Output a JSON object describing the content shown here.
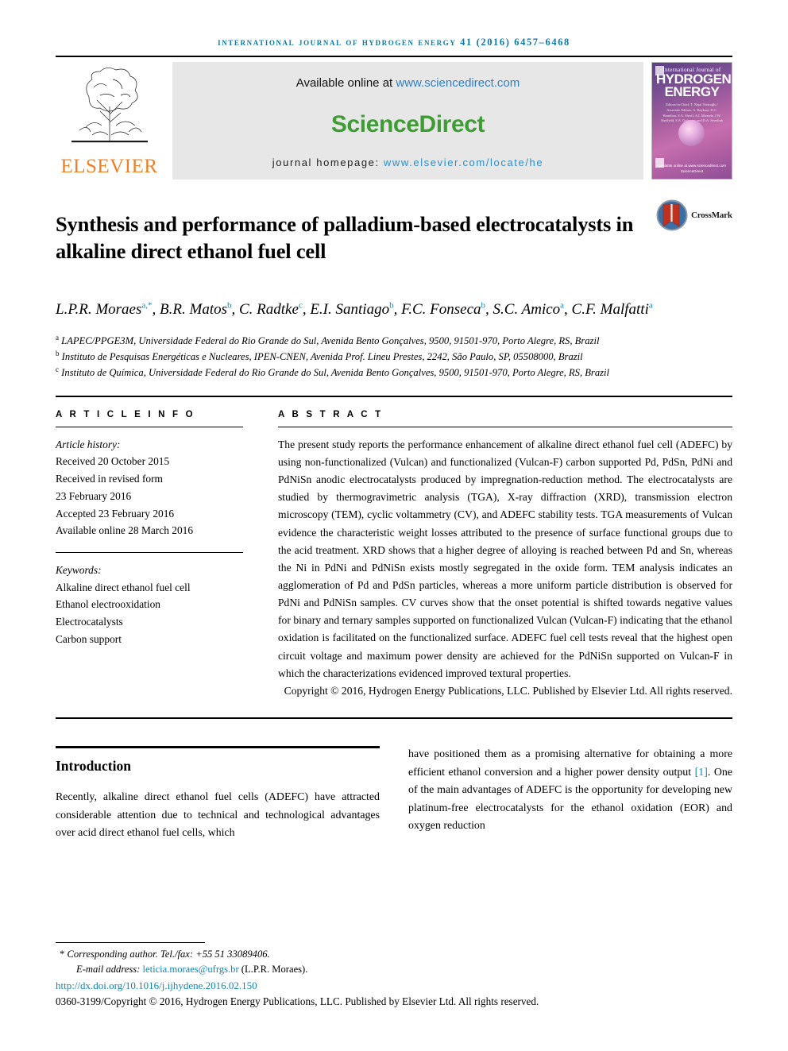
{
  "running_head": "International Journal of Hydrogen Energy 41 (2016) 6457–6468",
  "masthead": {
    "publisher": "ELSEVIER",
    "available_prefix": "Available online at ",
    "available_url": "www.sciencedirect.com",
    "sciencedirect_logo": "ScienceDirect",
    "homepage_prefix": "journal homepage: ",
    "homepage_url": "www.elsevier.com/locate/he",
    "cover": {
      "line1": "International Journal of",
      "line2": "HYDROGEN",
      "line3": "ENERGY",
      "editors": "Editors-in-Chief: T. Nejat Veziroğlu / Associate Editors: A. Baykara, D.C. Hamilton, S.A. Sherif, A.I. Miranda, J.W. Sheffield, S.A. Grigoriev and D.A. Serediuk",
      "sciencedirect": "Available online at www.sciencedirect.com ScienceDirect"
    }
  },
  "article": {
    "title": "Synthesis and performance of palladium-based electrocatalysts in alkaline direct ethanol fuel cell",
    "crossmark_label": "CrossMark",
    "authors": [
      {
        "name": "L.P.R. Moraes",
        "sup": "a,*"
      },
      {
        "name": "B.R. Matos",
        "sup": "b"
      },
      {
        "name": "C. Radtke",
        "sup": "c"
      },
      {
        "name": "E.I. Santiago",
        "sup": "b"
      },
      {
        "name": "F.C. Fonseca",
        "sup": "b"
      },
      {
        "name": "S.C. Amico",
        "sup": "a"
      },
      {
        "name": "C.F. Malfatti",
        "sup": "a"
      }
    ],
    "affiliations": [
      {
        "sup": "a",
        "text": "LAPEC/PPGE3M, Universidade Federal do Rio Grande do Sul, Avenida Bento Gonçalves, 9500, 91501-970, Porto Alegre, RS, Brazil"
      },
      {
        "sup": "b",
        "text": "Instituto de Pesquisas Energéticas e Nucleares, IPEN-CNEN, Avenida Prof. Lineu Prestes, 2242, São Paulo, SP, 05508000, Brazil"
      },
      {
        "sup": "c",
        "text": "Instituto de Química, Universidade Federal do Rio Grande do Sul, Avenida Bento Gonçalves, 9500, 91501-970, Porto Alegre, RS, Brazil"
      }
    ]
  },
  "article_info": {
    "heading": "A R T I C L E   I N F O",
    "history_label": "Article history:",
    "history": [
      "Received 20 October 2015",
      "Received in revised form",
      "23 February 2016",
      "Accepted 23 February 2016",
      "Available online 28 March 2016"
    ],
    "keywords_label": "Keywords:",
    "keywords": [
      "Alkaline direct ethanol fuel cell",
      "Ethanol electrooxidation",
      "Electrocatalysts",
      "Carbon support"
    ]
  },
  "abstract": {
    "heading": "A B S T R A C T",
    "body": "The present study reports the performance enhancement of alkaline direct ethanol fuel cell (ADEFC) by using non-functionalized (Vulcan) and functionalized (Vulcan-F) carbon supported Pd, PdSn, PdNi and PdNiSn anodic electrocatalysts produced by impregnation-reduction method. The electrocatalysts are studied by thermogravimetric analysis (TGA), X-ray diffraction (XRD), transmission electron microscopy (TEM), cyclic voltammetry (CV), and ADEFC stability tests. TGA measurements of Vulcan evidence the characteristic weight losses attributed to the presence of surface functional groups due to the acid treatment. XRD shows that a higher degree of alloying is reached between Pd and Sn, whereas the Ni in PdNi and PdNiSn exists mostly segregated in the oxide form. TEM analysis indicates an agglomeration of Pd and PdSn particles, whereas a more uniform particle distribution is observed for PdNi and PdNiSn samples. CV curves show that the onset potential is shifted towards negative values for binary and ternary samples supported on functionalized Vulcan (Vulcan-F) indicating that the ethanol oxidation is facilitated on the functionalized surface. ADEFC fuel cell tests reveal that the highest open circuit voltage and maximum power density are achieved for the PdNiSn supported on Vulcan-F in which the characterizations evidenced improved textural properties.",
    "copyright": "Copyright © 2016, Hydrogen Energy Publications, LLC. Published by Elsevier Ltd. All rights reserved."
  },
  "introduction": {
    "heading": "Introduction",
    "left_paragraph": "Recently, alkaline direct ethanol fuel cells (ADEFC) have attracted considerable attention due to technical and technological advantages over acid direct ethanol fuel cells, which",
    "right_paragraph_pre": "have positioned them as a promising alternative for obtaining a more efficient ethanol conversion and a higher power density output ",
    "right_paragraph_ref": "[1]",
    "right_paragraph_post": ". One of the main advantages of ADEFC is the opportunity for developing new platinum-free electrocatalysts for the ethanol oxidation (EOR) and oxygen reduction"
  },
  "footer": {
    "corresponding_star": "*",
    "corresponding": " Corresponding author. Tel./fax: +55 51 33089406.",
    "email_label": "E-mail address: ",
    "email": "leticia.moraes@ufrgs.br",
    "email_owner": " (L.P.R. Moraes).",
    "doi": "http://dx.doi.org/10.1016/j.ijhydene.2016.02.150",
    "issn_copyright": "0360-3199/Copyright © 2016, Hydrogen Energy Publications, LLC. Published by Elsevier Ltd. All rights reserved."
  },
  "colors": {
    "running_head": "#0b7aa5",
    "elsevier_orange": "#f08023",
    "sciencedirect_green": "#3f9c35",
    "link_blue": "#1186b4",
    "banner_gray": "#e7e7e7"
  }
}
